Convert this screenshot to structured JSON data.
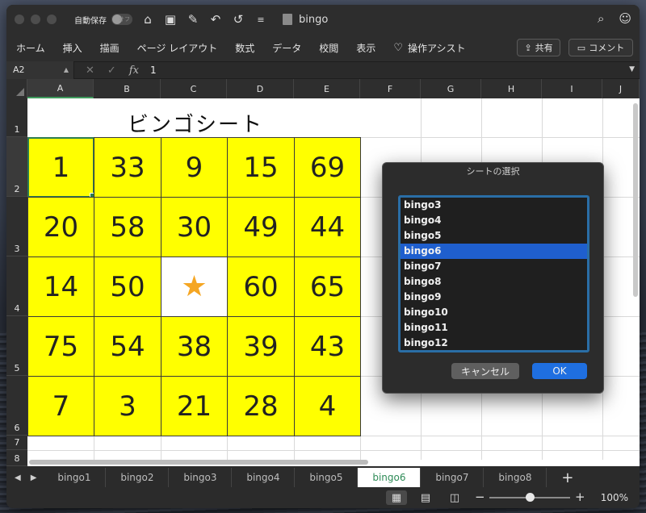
{
  "title_bar": {
    "autosave_label": "自動保存",
    "autosave_state": "オフ",
    "icons": [
      "home-icon",
      "save-icon",
      "edit-icon",
      "undo-icon",
      "redo-icon",
      "customize-icon"
    ],
    "document_name": "bingo"
  },
  "menu": {
    "items": [
      "ホーム",
      "挿入",
      "描画",
      "ページ レイアウト",
      "数式",
      "データ",
      "校閲",
      "表示"
    ],
    "assist": "操作アシスト",
    "share": "共有",
    "comment": "コメント"
  },
  "formula_bar": {
    "name_box": "A2",
    "fx": "fx",
    "value": "1"
  },
  "columns": [
    "A",
    "B",
    "C",
    "D",
    "E",
    "F",
    "G",
    "H",
    "I",
    "J"
  ],
  "rows": [
    "1",
    "2",
    "3",
    "4",
    "5",
    "6",
    "7",
    "8"
  ],
  "sheet": {
    "title": "ビンゴシート",
    "free_symbol": "★",
    "grid": [
      [
        "1",
        "33",
        "9",
        "15",
        "69"
      ],
      [
        "20",
        "58",
        "30",
        "49",
        "44"
      ],
      [
        "14",
        "50",
        "★",
        "60",
        "65"
      ],
      [
        "75",
        "54",
        "38",
        "39",
        "43"
      ],
      [
        "7",
        "3",
        "21",
        "28",
        "4"
      ]
    ],
    "colors": {
      "cell_fill": "#ffff00",
      "star": "#f5a623",
      "selection": "#2e7d4f"
    }
  },
  "tabs": {
    "items": [
      "bingo1",
      "bingo2",
      "bingo3",
      "bingo4",
      "bingo5",
      "bingo6",
      "bingo7",
      "bingo8"
    ],
    "active": "bingo6",
    "add": "+"
  },
  "status": {
    "zoom": "100%",
    "zoom_level": 0.5,
    "minus": "−",
    "plus": "+"
  },
  "dialog": {
    "title": "シートの選択",
    "items": [
      "bingo3",
      "bingo4",
      "bingo5",
      "bingo6",
      "bingo7",
      "bingo8",
      "bingo9",
      "bingo10",
      "bingo11",
      "bingo12"
    ],
    "selected": "bingo6",
    "cancel": "キャンセル",
    "ok": "OK"
  }
}
